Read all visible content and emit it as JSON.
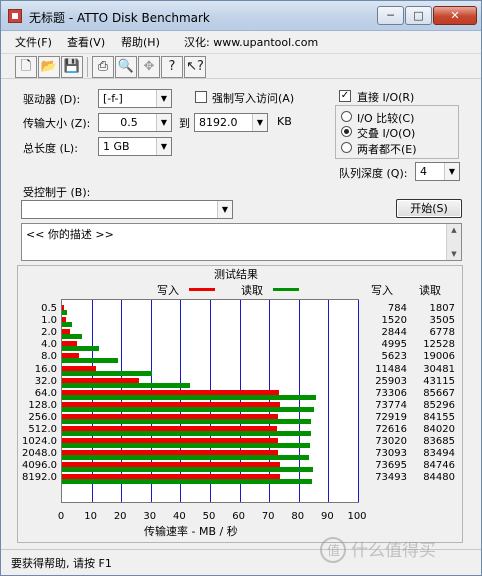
{
  "window": {
    "title": "无标题 - ATTO Disk Benchmark"
  },
  "titlebar": {
    "min": "─",
    "max": "□",
    "close": "✕"
  },
  "menu": [
    "文件(F)",
    "查看(V)",
    "帮助(H)",
    "汉化: www.upantool.com"
  ],
  "settings": {
    "drive_label": "驱动器 (D):",
    "drive_value": "[-f-]",
    "force_write_label": "强制写入访问(A)",
    "force_write_checked": false,
    "transfer_label": "传输大小 (Z):",
    "transfer_from": "0.5",
    "transfer_to_label": "到",
    "transfer_to": "8192.0",
    "transfer_unit": "KB",
    "length_label": "总长度 (L):",
    "length_value": "1 GB",
    "direct_io_label": "直接 I/O(R)",
    "direct_io_checked": true,
    "io_compare": "I/O 比较(C)",
    "overlapped_io": "交叠 I/O(O)",
    "neither": "两者都不(E)",
    "selected_io_mode": "overlapped",
    "queue_label": "队列深度 (Q):",
    "queue_value": "4",
    "controlled_label": "受控制于 (B):",
    "controlled_value": "",
    "start_label": "开始(S)"
  },
  "description": {
    "text": "<<  你的描述   >>"
  },
  "results": {
    "title": "测试结果",
    "legend_write": "写入",
    "legend_read": "读取",
    "col_write": "写入",
    "col_read": "读取",
    "write_color": "#ee0000",
    "read_color": "#009000"
  },
  "chart_data": {
    "type": "bar",
    "orientation": "horizontal",
    "title": "测试结果",
    "xlabel": "传输速率 - MB / 秒",
    "xlim": [
      0,
      100
    ],
    "xticks": [
      "0",
      "10",
      "20",
      "30",
      "40",
      "50",
      "60",
      "70",
      "80",
      "90",
      "100"
    ],
    "grid": true,
    "categories": [
      "0.5",
      "1.0",
      "2.0",
      "4.0",
      "8.0",
      "16.0",
      "32.0",
      "64.0",
      "128.0",
      "256.0",
      "512.0",
      "1024.0",
      "2048.0",
      "4096.0",
      "8192.0"
    ],
    "series": [
      {
        "name": "写入",
        "values": [
          784,
          1520,
          2844,
          4995,
          5623,
          11484,
          25903,
          73306,
          73774,
          72919,
          72616,
          73020,
          73093,
          73695,
          73493
        ]
      },
      {
        "name": "读取",
        "values": [
          1807,
          3505,
          6778,
          12528,
          19006,
          30481,
          43115,
          85667,
          85296,
          84155,
          84020,
          83685,
          83494,
          84746,
          84480
        ]
      }
    ]
  },
  "status": {
    "text": "要获得帮助, 请按 F1"
  },
  "watermark": {
    "text": "什么值得买"
  },
  "icons": [
    "new-icon",
    "open-icon",
    "save-icon",
    "print-icon",
    "print-preview-icon",
    "move-icon",
    "help-icon",
    "context-help-icon"
  ]
}
